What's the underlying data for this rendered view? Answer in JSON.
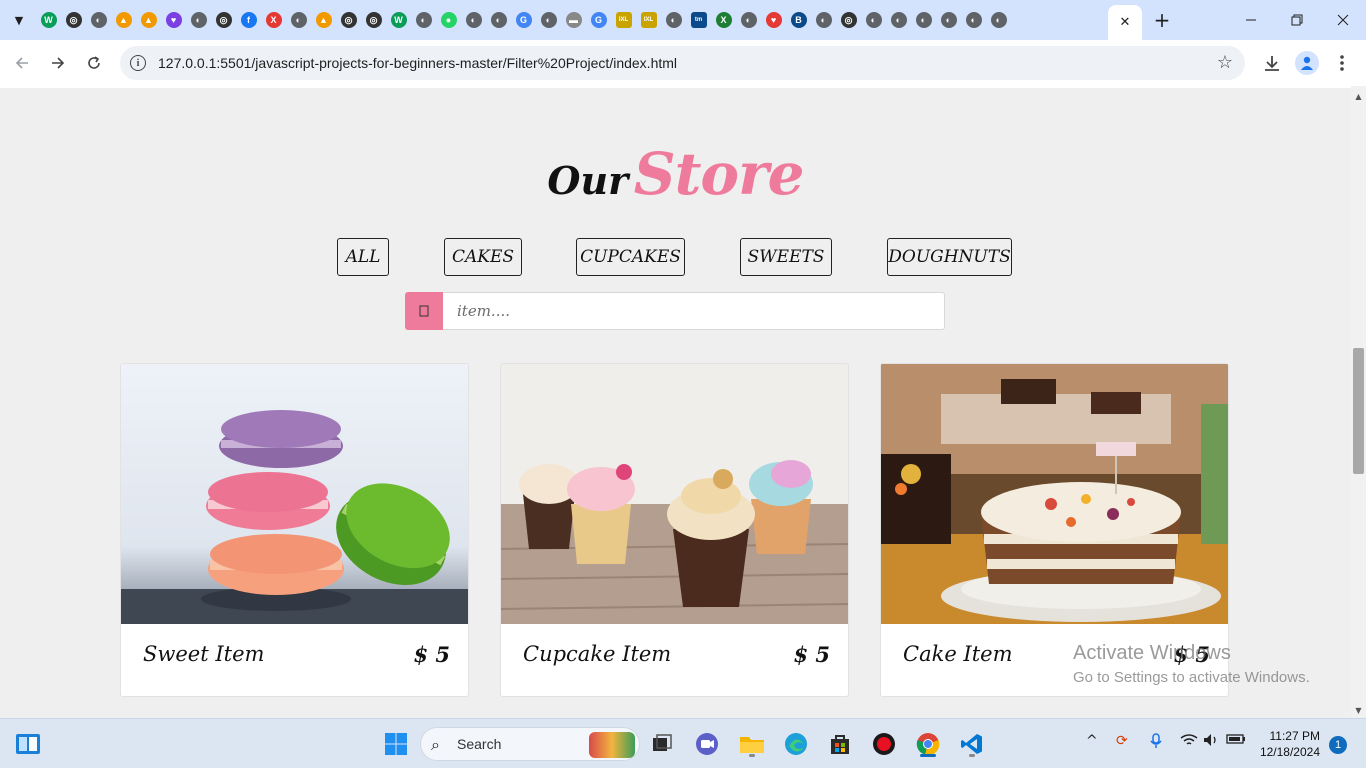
{
  "browser": {
    "url": "127.0.0.1:5501/javascript-projects-for-beginners-master/Filter%20Project/index.html",
    "active_tab_close": "✕",
    "new_tab": "+",
    "tab_favicons": [
      "W",
      "◎",
      "◐",
      "▲",
      "▲",
      "♥",
      "◐",
      "◎",
      "f",
      "X",
      "◐",
      "▲",
      "◎",
      "◎",
      "W",
      "◐",
      "●",
      "◐",
      "◐",
      "G",
      "◐",
      "▬",
      "G",
      "IXL",
      "IXL",
      "◐",
      "tm",
      "X",
      "◐",
      "♥",
      "B",
      "◐",
      "◎",
      "◐",
      "◐",
      "◐",
      "◐",
      "◐",
      "◐"
    ]
  },
  "page": {
    "heading_part1": "Our",
    "heading_part2": "Store",
    "filters": [
      "ALL",
      "CAKES",
      "CUPCAKES",
      "SWEETS",
      "DOUGHNUTS"
    ],
    "search": {
      "placeholder": "item...."
    },
    "products": [
      {
        "name": "Sweet Item",
        "price": "$ 5"
      },
      {
        "name": "Cupcake Item",
        "price": "$ 5"
      },
      {
        "name": "Cake Item",
        "price": "$ 5"
      }
    ]
  },
  "watermark": {
    "line1": "Activate Windows",
    "line2": "Go to Settings to activate Windows."
  },
  "taskbar": {
    "search_label": "Search",
    "time": "11:27 PM",
    "date": "12/18/2024",
    "notification_count": "1"
  },
  "colors": {
    "accent_pink": "#ef7b9c",
    "tab_strip": "#d3e3fd",
    "taskbar": "#dce6f2"
  }
}
